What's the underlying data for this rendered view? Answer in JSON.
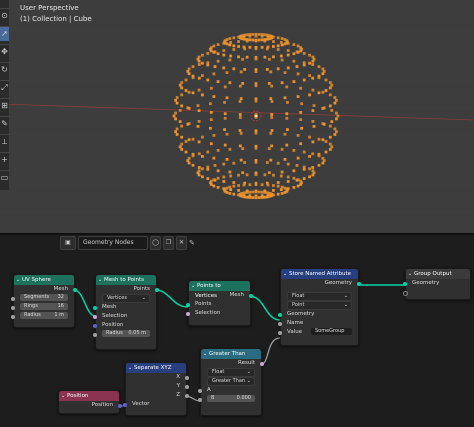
{
  "viewport": {
    "title": "User Perspective",
    "subtitle": "(1) Collection | Cube",
    "point_color": "#e8912d",
    "background": "#3d3d3d",
    "toolbar_icons": [
      "view-icon",
      "cursor-icon",
      "move-icon",
      "rotate-icon",
      "scale-icon",
      "transform-icon",
      "annotate-icon",
      "measure-icon",
      "add-icon",
      "extrude-icon"
    ]
  },
  "editor": {
    "tree_name": "Geometry Nodes",
    "icons": [
      "editor-type-icon",
      "shield-icon",
      "copy-icon",
      "close-icon",
      "pin-icon"
    ]
  },
  "colors": {
    "geometry": "#00d6a3",
    "vector": "#6363c7",
    "boolean": "#cca6d6",
    "float": "#a1a1a1",
    "header_green": "#1d725e",
    "header_blue": "#273f7f",
    "header_position": "#8a3350",
    "header_util": "#2b6b7f",
    "header_output": "#3b3b3b"
  },
  "nodes": {
    "uv_sphere": {
      "title": "UV Sphere",
      "output": "Mesh",
      "segments_label": "Segments",
      "segments": "32",
      "rings_label": "Rings",
      "rings": "16",
      "radius_label": "Radius",
      "radius": "1 m"
    },
    "mesh_to_points": {
      "title": "Mesh to Points",
      "output": "Points",
      "mode": "Vertices",
      "in_mesh": "Mesh",
      "in_selection": "Selection",
      "in_position": "Position",
      "radius_label": "Radius",
      "radius": "0.05 m"
    },
    "points_to_vertices": {
      "title": "Points to Vertices",
      "output": "Mesh",
      "in_points": "Points",
      "in_selection": "Selection"
    },
    "store_named_attribute": {
      "title": "Store Named Attribute",
      "output": "Geometry",
      "type": "Float",
      "domain": "Point",
      "in_geometry": "Geometry",
      "name_label": "Name",
      "name_value": "SomeGroup",
      "in_value": "Value"
    },
    "group_output": {
      "title": "Group Output",
      "input": "Geometry"
    },
    "greater_than": {
      "title": "Greater Than",
      "output": "Result",
      "type": "Float",
      "mode": "Greater Than",
      "a_label": "A",
      "b_label": "B",
      "b_value": "0.000"
    },
    "separate_xyz": {
      "title": "Separate XYZ",
      "out_x": "X",
      "out_y": "Y",
      "out_z": "Z",
      "input": "Vector"
    },
    "position": {
      "title": "Position",
      "output": "Position"
    }
  }
}
